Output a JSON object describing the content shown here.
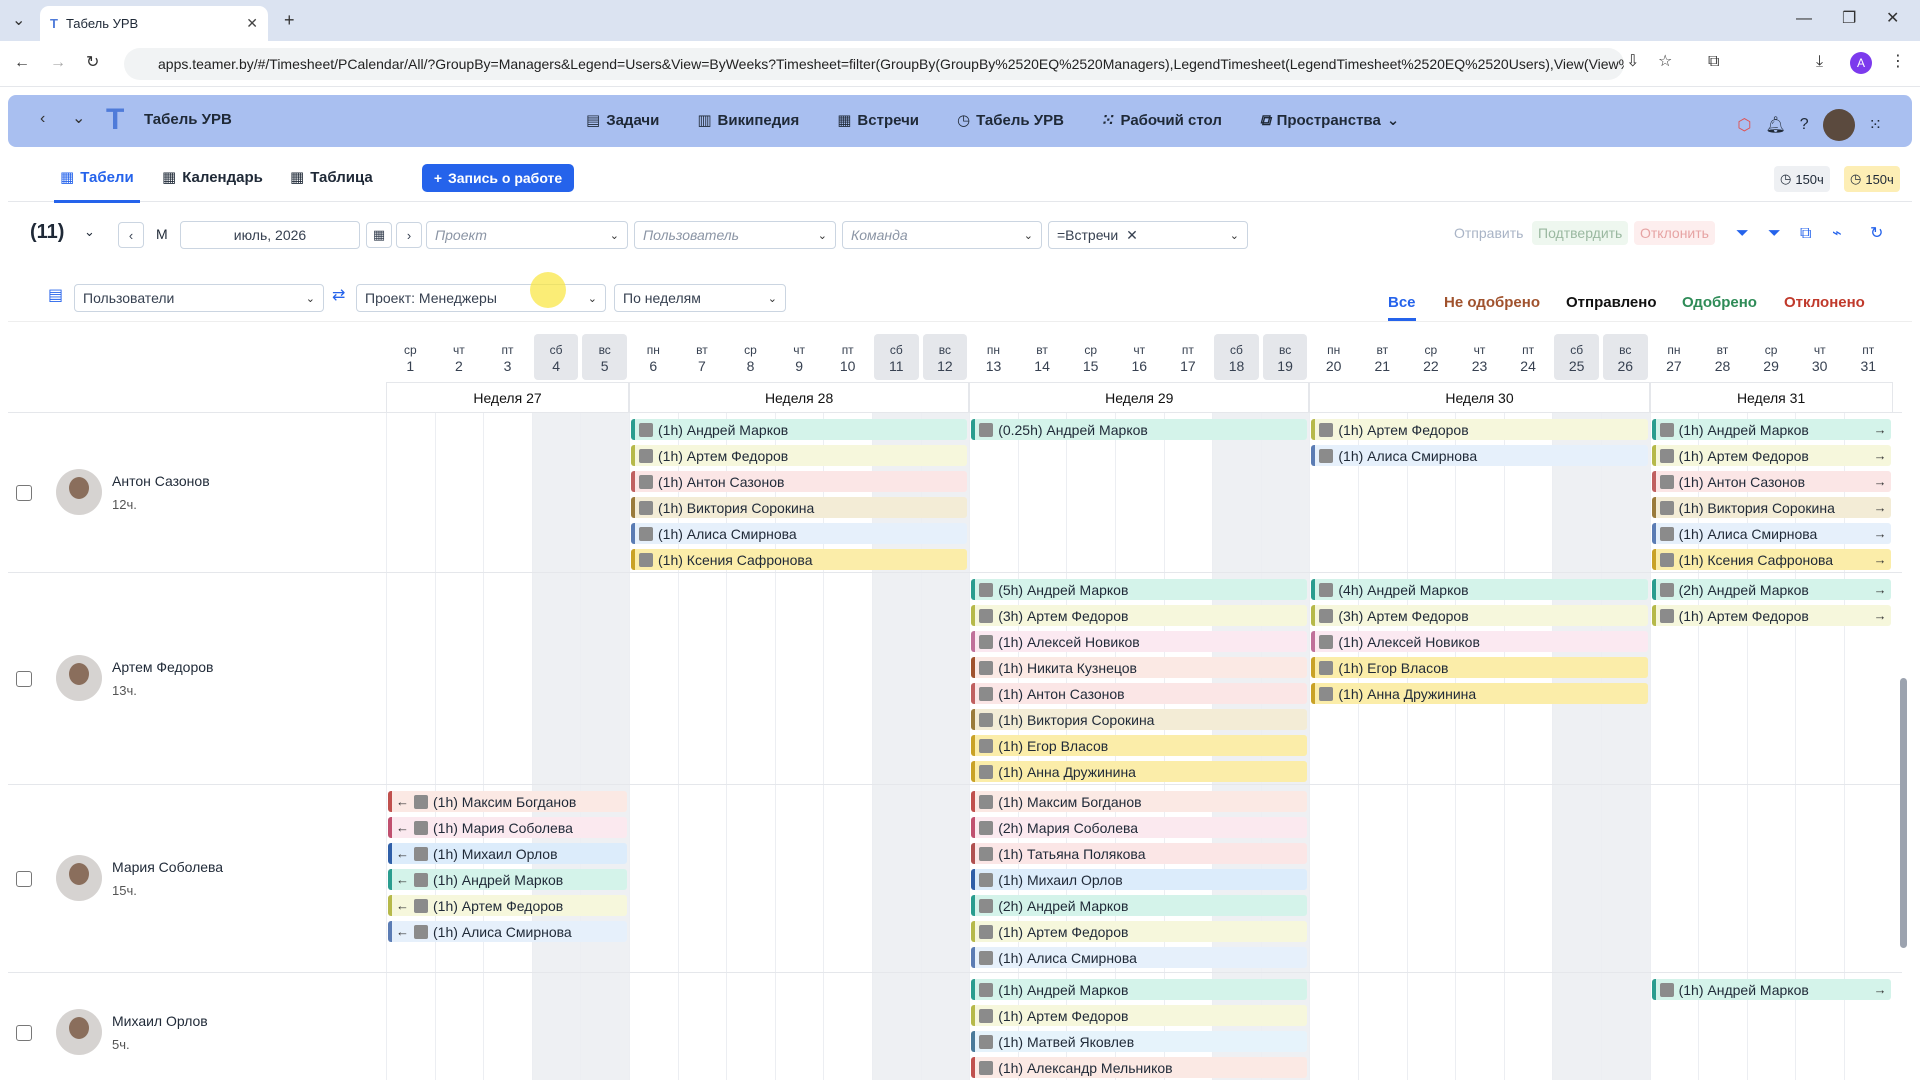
{
  "browser": {
    "tab_title": "Табель УРВ",
    "url": "apps.teamer.by/#/Timesheet/PCalendar/All/?GroupBy=Managers&Legend=Users&View=ByWeeks?Timesheet=filter(GroupBy(GroupBy%2520EQ%2520Managers),LegendTimesheet(LegendTimesheet%2520EQ%2520Users),View(View%...",
    "profile": "A"
  },
  "app": {
    "title": "Табель УРВ",
    "nav": [
      "Задачи",
      "Википедия",
      "Встречи",
      "Табель УРВ",
      "Рабочий стол",
      "Пространства"
    ]
  },
  "tabs": [
    "Табели",
    "Календарь",
    "Таблица"
  ],
  "add_button": "Запись о работе",
  "hours": [
    "150ч",
    "150ч"
  ],
  "filters": {
    "count": "(11)",
    "mode": "М",
    "month": "июль, 2026",
    "project": "Проект",
    "user": "Пользователь",
    "team": "Команда",
    "chip": "=Встречи"
  },
  "actions": [
    "Отправить",
    "Подтвердить",
    "Отклонить"
  ],
  "grouping": {
    "legend": "Пользователи",
    "group": "Проект: Менеджеры",
    "view": "По неделям"
  },
  "status_tabs": [
    "Все",
    "Не одобрено",
    "Отправлено",
    "Одобрено",
    "Отклонено"
  ],
  "days": [
    [
      "ср",
      "1"
    ],
    [
      "чт",
      "2"
    ],
    [
      "пт",
      "3"
    ],
    [
      "сб",
      "4"
    ],
    [
      "вс",
      "5"
    ],
    [
      "пн",
      "6"
    ],
    [
      "вт",
      "7"
    ],
    [
      "ср",
      "8"
    ],
    [
      "чт",
      "9"
    ],
    [
      "пт",
      "10"
    ],
    [
      "сб",
      "11"
    ],
    [
      "вс",
      "12"
    ],
    [
      "пн",
      "13"
    ],
    [
      "вт",
      "14"
    ],
    [
      "ср",
      "15"
    ],
    [
      "чт",
      "16"
    ],
    [
      "пт",
      "17"
    ],
    [
      "сб",
      "18"
    ],
    [
      "вс",
      "19"
    ],
    [
      "пн",
      "20"
    ],
    [
      "вт",
      "21"
    ],
    [
      "ср",
      "22"
    ],
    [
      "чт",
      "23"
    ],
    [
      "пт",
      "24"
    ],
    [
      "сб",
      "25"
    ],
    [
      "вс",
      "26"
    ],
    [
      "пн",
      "27"
    ],
    [
      "вт",
      "28"
    ],
    [
      "ср",
      "29"
    ],
    [
      "чт",
      "30"
    ],
    [
      "пт",
      "31"
    ]
  ],
  "weeks": [
    "Неделя 27",
    "Неделя 28",
    "Неделя 29",
    "Неделя 30",
    "Неделя 31"
  ],
  "rows": [
    {
      "name": "Антон Сазонов",
      "hours": "12ч.",
      "height": 160,
      "entries": [
        [
          1,
          0,
          "(1h) Андрей Марков",
          "#d4f3ea",
          "#2a9d8f"
        ],
        [
          1,
          1,
          "(1h) Артем Федоров",
          "#f6f7dc",
          "#b6b94a"
        ],
        [
          1,
          2,
          "(1h) Антон Сазонов",
          "#fbe6e6",
          "#c06060"
        ],
        [
          1,
          3,
          "(1h) Виктория Сорокина",
          "#f3ecd6",
          "#9a7b3b"
        ],
        [
          1,
          4,
          "(1h) Алиса Смирнова",
          "#e6f0fb",
          "#5b7cb4"
        ],
        [
          1,
          5,
          "(1h) Ксения Сафронова",
          "#fbeda9",
          "#c9a227"
        ],
        [
          2,
          0,
          "(0.25h) Андрей Марков",
          "#d4f3ea",
          "#2a9d8f"
        ],
        [
          3,
          0,
          "(1h) Артем Федоров",
          "#f6f7dc",
          "#b6b94a"
        ],
        [
          3,
          1,
          "(1h) Алиса Смирнова",
          "#e6f0fb",
          "#5b7cb4"
        ],
        [
          4,
          0,
          "(1h) Андрей Марков",
          "#d4f3ea",
          "#2a9d8f"
        ],
        [
          4,
          1,
          "(1h) Артем Федоров",
          "#f6f7dc",
          "#b6b94a"
        ],
        [
          4,
          2,
          "(1h) Антон Сазонов",
          "#fbe6e6",
          "#c06060"
        ],
        [
          4,
          3,
          "(1h) Виктория Сорокина",
          "#f3ecd6",
          "#9a7b3b"
        ],
        [
          4,
          4,
          "(1h) Алиса Смирнова",
          "#e6f0fb",
          "#5b7cb4"
        ],
        [
          4,
          5,
          "(1h) Ксения Сафронова",
          "#fbeda9",
          "#c9a227"
        ]
      ]
    },
    {
      "name": "Артем Федоров",
      "hours": "13ч.",
      "height": 212,
      "entries": [
        [
          2,
          0,
          "(5h) Андрей Марков",
          "#d4f3ea",
          "#2a9d8f"
        ],
        [
          2,
          1,
          "(3h) Артем Федоров",
          "#f6f7dc",
          "#b6b94a"
        ],
        [
          2,
          2,
          "(1h) Алексей Новиков",
          "#fbe9f1",
          "#c0709a"
        ],
        [
          2,
          3,
          "(1h) Никита Кузнецов",
          "#fbe9e4",
          "#a0522d"
        ],
        [
          2,
          4,
          "(1h) Антон Сазонов",
          "#fbe6e6",
          "#c06060"
        ],
        [
          2,
          5,
          "(1h) Виктория Сорокина",
          "#f3ecd6",
          "#9a7b3b"
        ],
        [
          2,
          6,
          "(1h) Егор Власов",
          "#fbeda9",
          "#c9a227"
        ],
        [
          2,
          7,
          "(1h) Анна Дружинина",
          "#fbeda9",
          "#c9a227"
        ],
        [
          3,
          0,
          "(4h) Андрей Марков",
          "#d4f3ea",
          "#2a9d8f"
        ],
        [
          3,
          1,
          "(3h) Артем Федоров",
          "#f6f7dc",
          "#b6b94a"
        ],
        [
          3,
          2,
          "(1h) Алексей Новиков",
          "#fbe9f1",
          "#c0709a"
        ],
        [
          3,
          3,
          "(1h) Егор Власов",
          "#fbeda9",
          "#c9a227"
        ],
        [
          3,
          4,
          "(1h) Анна Дружинина",
          "#fbeda9",
          "#c9a227"
        ],
        [
          4,
          0,
          "(2h) Андрей Марков",
          "#d4f3ea",
          "#2a9d8f"
        ],
        [
          4,
          1,
          "(1h) Артем Федоров",
          "#f6f7dc",
          "#b6b94a"
        ]
      ]
    },
    {
      "name": "Мария Соболева",
      "hours": "15ч.",
      "height": 188,
      "entries": [
        [
          0,
          0,
          "(1h) Максим Богданов",
          "#fbe9e4",
          "#c0504d"
        ],
        [
          0,
          1,
          "(1h) Мария Соболева",
          "#fbe9ef",
          "#c0506f"
        ],
        [
          0,
          2,
          "(1h) Михаил Орлов",
          "#dcecfb",
          "#2f5fa8"
        ],
        [
          0,
          3,
          "(1h) Андрей Марков",
          "#d4f3ea",
          "#2a9d8f"
        ],
        [
          0,
          4,
          "(1h) Артем Федоров",
          "#f6f7dc",
          "#b6b94a"
        ],
        [
          0,
          5,
          "(1h) Алиса Смирнова",
          "#e6f0fb",
          "#5b7cb4"
        ],
        [
          2,
          0,
          "(1h) Максим Богданов",
          "#fbe9e4",
          "#c0504d"
        ],
        [
          2,
          1,
          "(2h) Мария Соболева",
          "#fbe9ef",
          "#c0506f"
        ],
        [
          2,
          2,
          "(1h) Татьяна Полякова",
          "#fbe6e6",
          "#b05050"
        ],
        [
          2,
          3,
          "(1h) Михаил Орлов",
          "#dcecfb",
          "#2f5fa8"
        ],
        [
          2,
          4,
          "(2h) Андрей Марков",
          "#d4f3ea",
          "#2a9d8f"
        ],
        [
          2,
          5,
          "(1h) Артем Федоров",
          "#f6f7dc",
          "#b6b94a"
        ],
        [
          2,
          6,
          "(1h) Алиса Смирнова",
          "#e6f0fb",
          "#5b7cb4"
        ]
      ]
    },
    {
      "name": "Михаил Орлов",
      "hours": "5ч.",
      "height": 120,
      "entries": [
        [
          2,
          0,
          "(1h) Андрей Марков",
          "#d4f3ea",
          "#2a9d8f"
        ],
        [
          2,
          1,
          "(1h) Артем Федоров",
          "#f6f7dc",
          "#b6b94a"
        ],
        [
          2,
          2,
          "(1h) Матвей Яковлев",
          "#e6f3fb",
          "#4a7a9a"
        ],
        [
          2,
          3,
          "(1h) Александр Мельников",
          "#fbe9e4",
          "#c0504d"
        ],
        [
          4,
          0,
          "(1h) Андрей Марков",
          "#d4f3ea",
          "#2a9d8f"
        ]
      ]
    }
  ]
}
